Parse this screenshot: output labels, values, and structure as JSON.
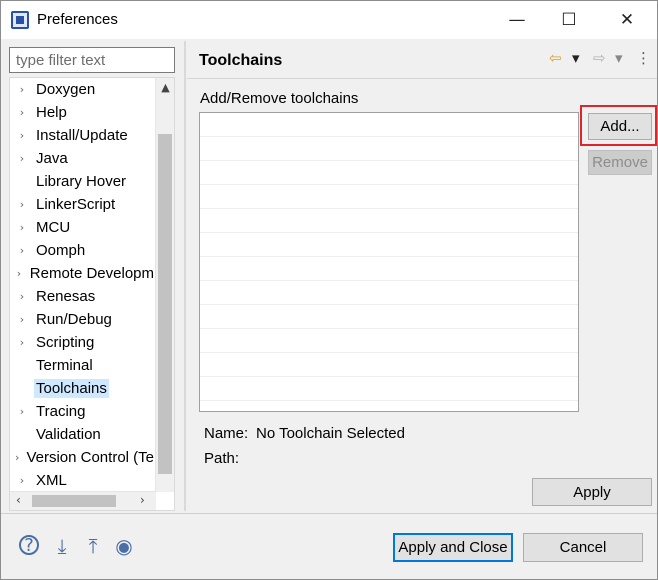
{
  "window": {
    "title": "Preferences",
    "minimize": "—",
    "maximize": "☐",
    "close": "✕"
  },
  "sidebar": {
    "filter_placeholder": "type filter text",
    "items": [
      {
        "label": "Doxygen",
        "expandable": true
      },
      {
        "label": "Help",
        "expandable": true
      },
      {
        "label": "Install/Update",
        "expandable": true
      },
      {
        "label": "Java",
        "expandable": true
      },
      {
        "label": "Library Hover",
        "expandable": false
      },
      {
        "label": "LinkerScript",
        "expandable": true
      },
      {
        "label": "MCU",
        "expandable": true
      },
      {
        "label": "Oomph",
        "expandable": true
      },
      {
        "label": "Remote Developm",
        "expandable": true
      },
      {
        "label": "Renesas",
        "expandable": true
      },
      {
        "label": "Run/Debug",
        "expandable": true
      },
      {
        "label": "Scripting",
        "expandable": true
      },
      {
        "label": "Terminal",
        "expandable": false
      },
      {
        "label": "Toolchains",
        "expandable": false,
        "selected": true
      },
      {
        "label": "Tracing",
        "expandable": true
      },
      {
        "label": "Validation",
        "expandable": false
      },
      {
        "label": "Version Control (Te",
        "expandable": true
      },
      {
        "label": "XML",
        "expandable": true
      }
    ]
  },
  "page": {
    "title": "Toolchains",
    "section_label": "Add/Remove toolchains",
    "add_button": "Add...",
    "remove_button": "Remove",
    "name_label": "Name:",
    "name_value": "No Toolchain Selected",
    "path_label": "Path:",
    "path_value": "",
    "apply_button": "Apply"
  },
  "footer": {
    "apply_close_button": "Apply and Close",
    "cancel_button": "Cancel"
  },
  "icons": {
    "back": "⇦",
    "dropdown": "▾",
    "forward": "⇨",
    "menu": "⋮",
    "expand_arrow": "›",
    "scroll_up": "▲",
    "scroll_down": "▼",
    "scroll_left": "‹",
    "scroll_right": "›",
    "help": "?",
    "import": "⤓",
    "export": "⤒",
    "record": "◉"
  },
  "colors": {
    "selection": "#cde8ff",
    "highlight": "#e0242c",
    "accent": "#0078d7"
  }
}
